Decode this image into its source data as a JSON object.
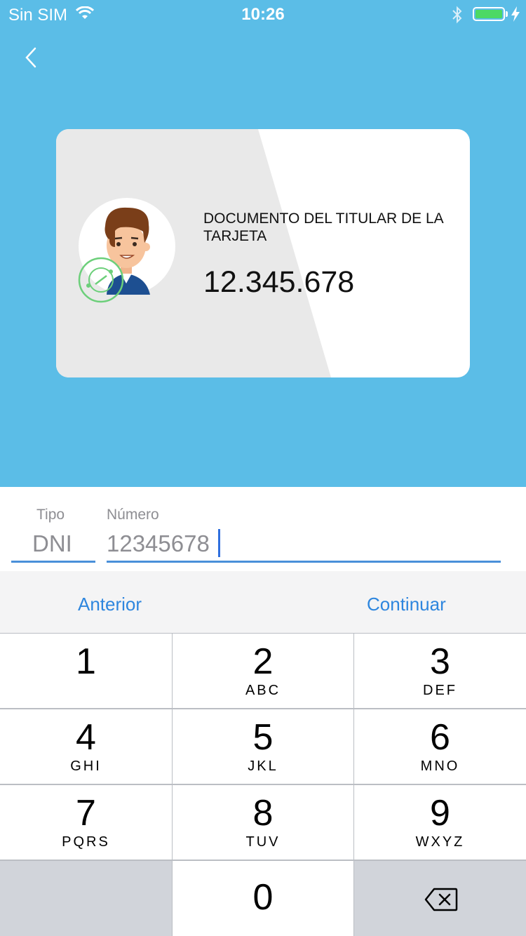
{
  "status_bar": {
    "carrier": "Sin SIM",
    "time": "10:26"
  },
  "card": {
    "document_label": "DOCUMENTO DEL TITULAR DE LA TARJETA",
    "document_number": "12.345.678"
  },
  "form": {
    "tipo_label": "Tipo",
    "tipo_value": "DNI",
    "numero_label": "Número",
    "numero_value": "12345678"
  },
  "toolbar": {
    "previous_label": "Anterior",
    "continue_label": "Continuar"
  },
  "keypad": {
    "keys": [
      {
        "digit": "1",
        "letters": ""
      },
      {
        "digit": "2",
        "letters": "ABC"
      },
      {
        "digit": "3",
        "letters": "DEF"
      },
      {
        "digit": "4",
        "letters": "GHI"
      },
      {
        "digit": "5",
        "letters": "JKL"
      },
      {
        "digit": "6",
        "letters": "MNO"
      },
      {
        "digit": "7",
        "letters": "PQRS"
      },
      {
        "digit": "8",
        "letters": "TUV"
      },
      {
        "digit": "9",
        "letters": "WXYZ"
      },
      {
        "digit": "0",
        "letters": ""
      }
    ]
  },
  "colors": {
    "header_bg": "#5bbde7",
    "accent": "#2e86de",
    "underline": "#4a90d9",
    "battery": "#4cd964"
  }
}
